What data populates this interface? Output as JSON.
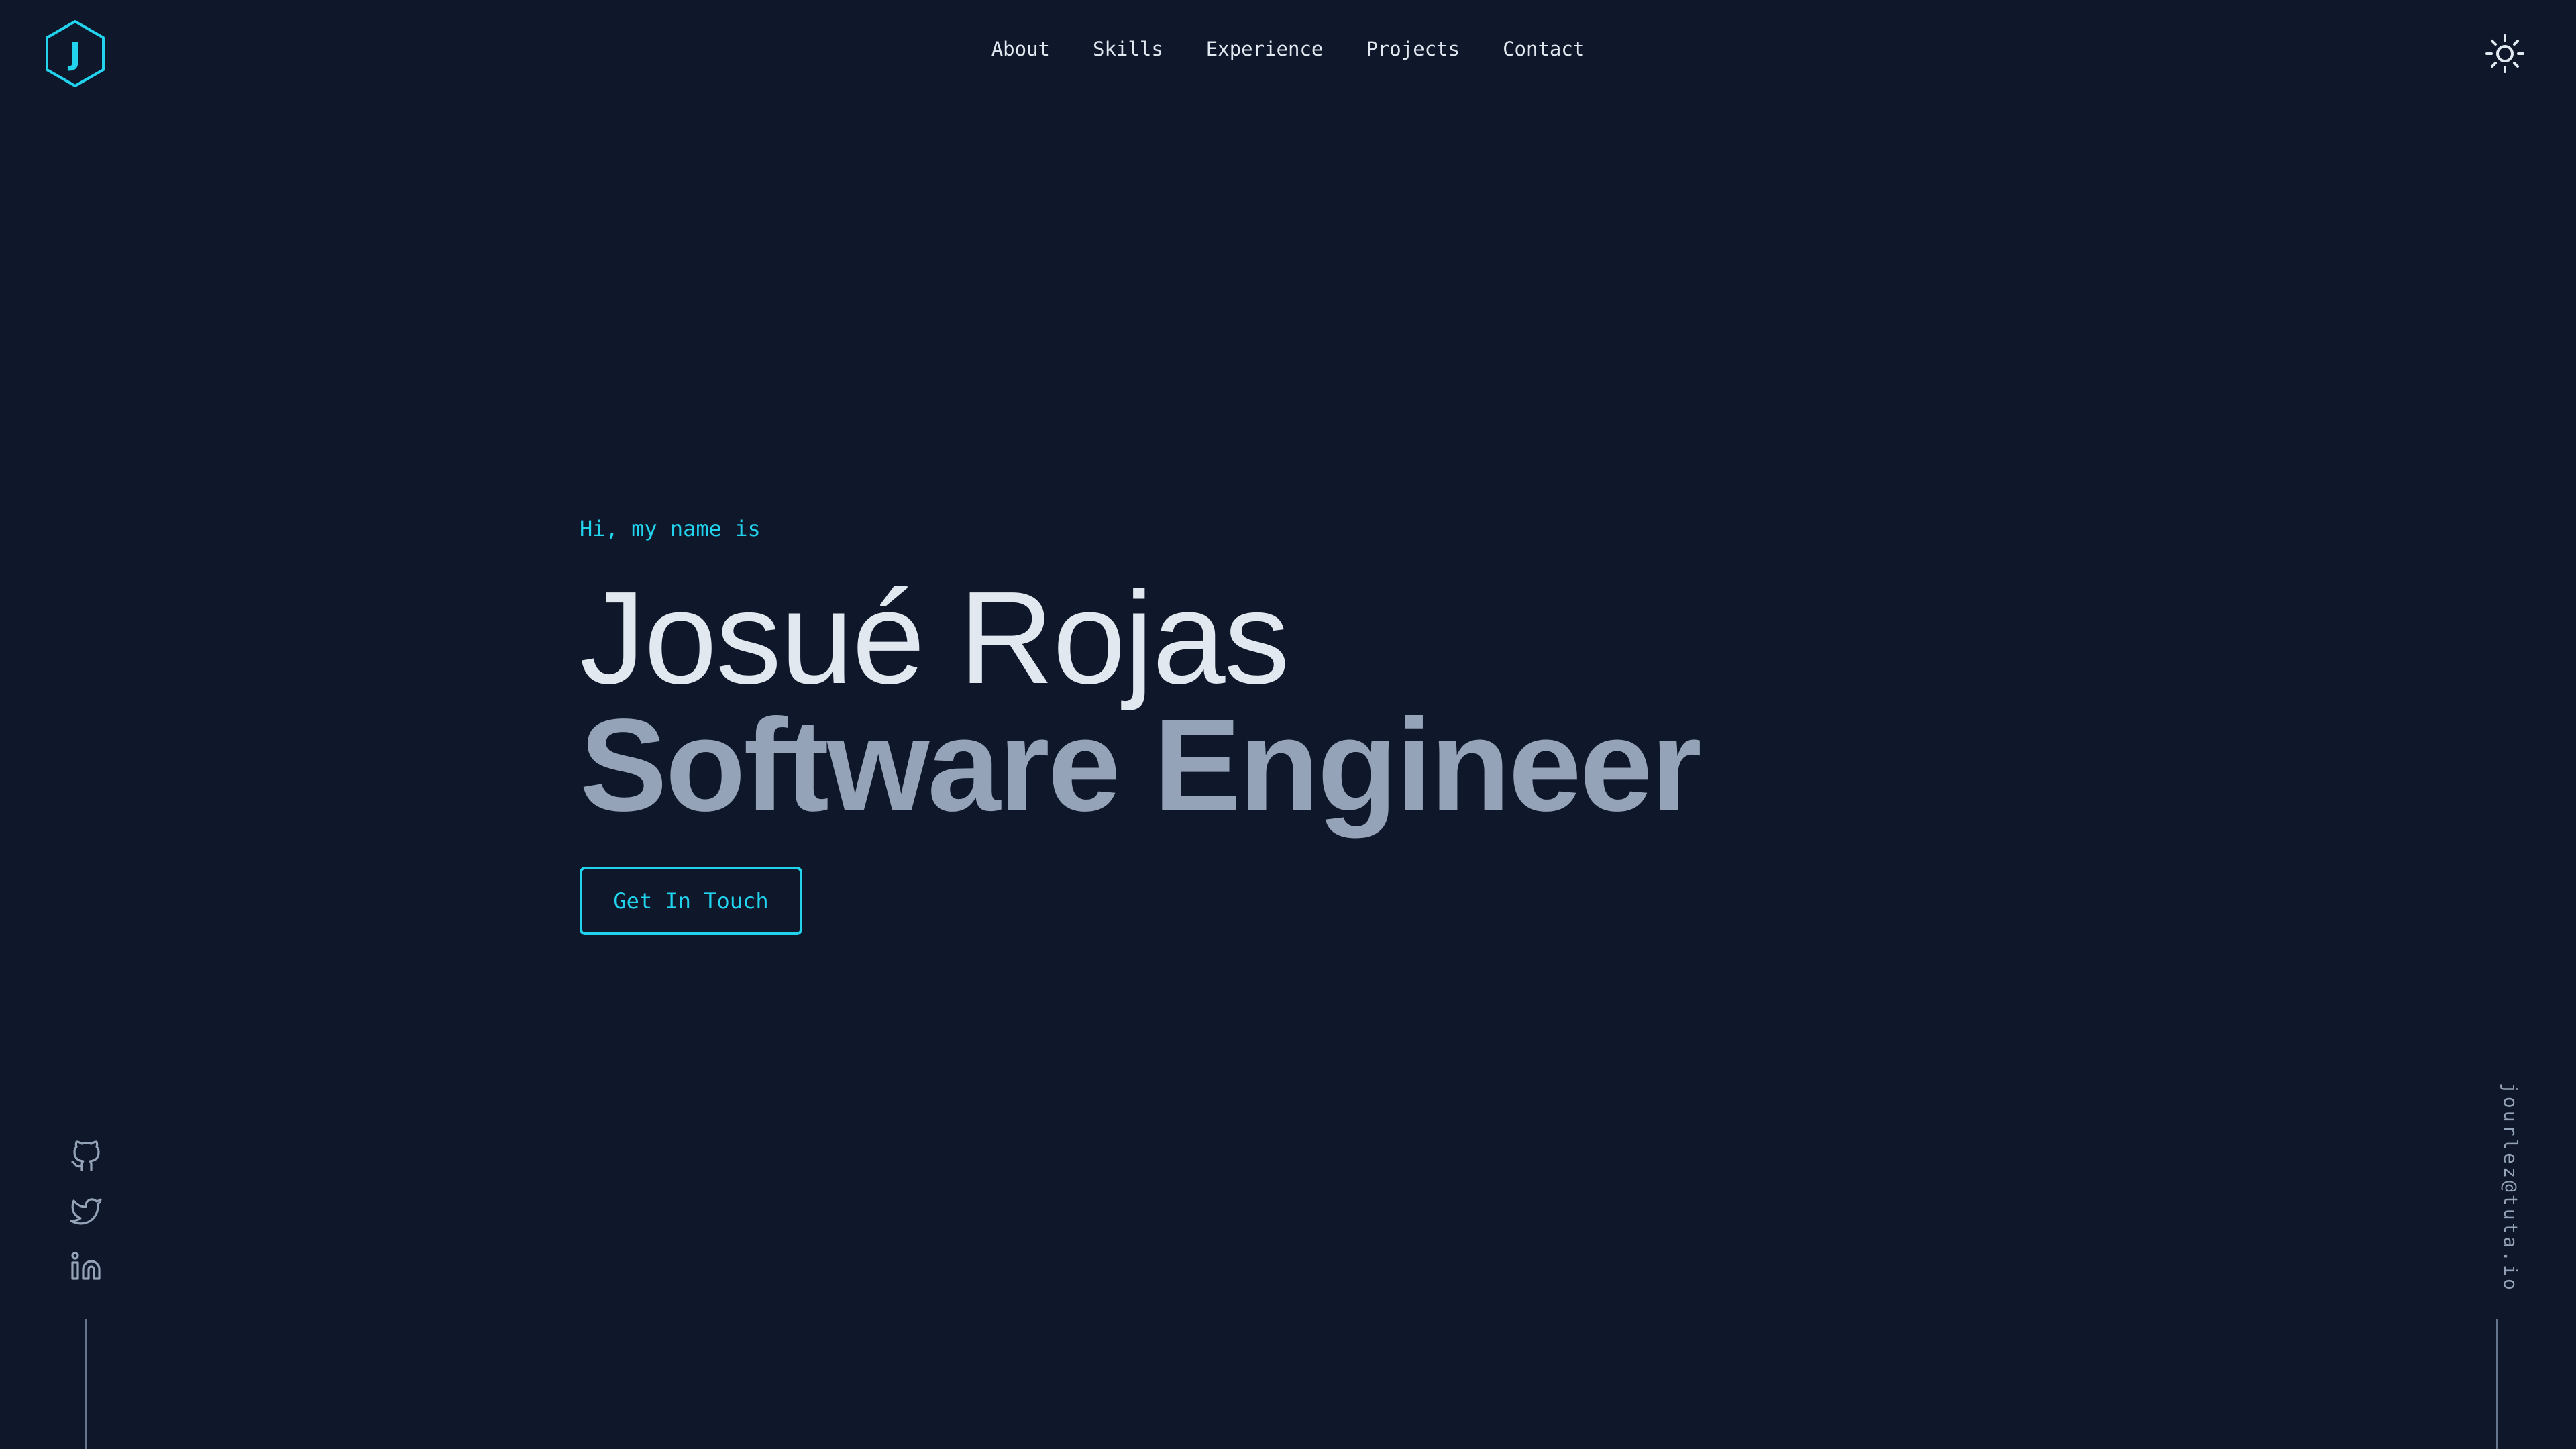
{
  "logo": {
    "letter": "J",
    "icon": "hexagon-logo-icon",
    "color": "#22d3ee"
  },
  "nav": {
    "items": [
      {
        "label": "About"
      },
      {
        "label": "Skills"
      },
      {
        "label": "Experience"
      },
      {
        "label": "Projects"
      },
      {
        "label": "Contact"
      }
    ]
  },
  "theme_toggle": {
    "icon": "sun-icon"
  },
  "hero": {
    "greeting": "Hi, my name is",
    "name": "Josué Rojas",
    "role": "Software Engineer",
    "cta_label": "Get In Touch"
  },
  "social": {
    "links": [
      {
        "icon": "github-icon"
      },
      {
        "icon": "twitter-icon"
      },
      {
        "icon": "linkedin-icon"
      }
    ]
  },
  "email": "jourlez@tuta.io",
  "colors": {
    "background": "#0f172a",
    "accent": "#22d3ee",
    "text": "#e2e8f0",
    "muted": "#94a3b8",
    "line": "#64748b"
  }
}
